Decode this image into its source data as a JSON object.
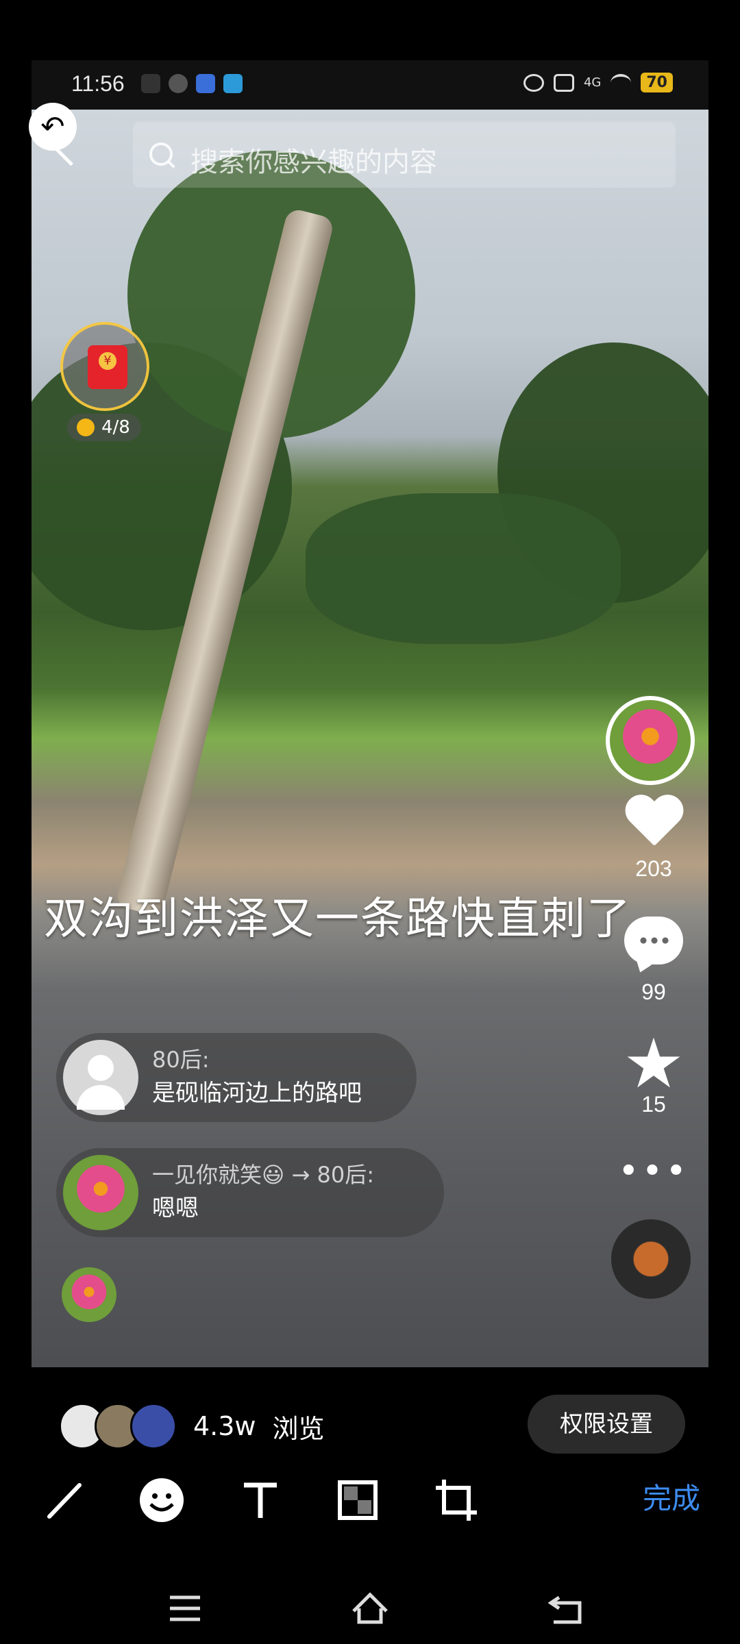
{
  "status_bar": {
    "time": "11:56",
    "battery": "70",
    "network": "4G"
  },
  "search": {
    "placeholder": "搜索你感兴趣的内容"
  },
  "red_packet": {
    "progress": "4/8"
  },
  "video": {
    "caption": "双沟到洪泽又一条路快直刺了"
  },
  "actions": {
    "likes": "203",
    "comments": "99",
    "favorites": "15"
  },
  "comments": [
    {
      "name": "80后:",
      "text": "是砚临河边上的路吧"
    },
    {
      "name": "一见你就笑😃 → 80后:",
      "text": "嗯嗯"
    }
  ],
  "viewers": {
    "count": "4.3w",
    "label": "浏览"
  },
  "buttons": {
    "permission": "权限设置",
    "done": "完成"
  },
  "colors": {
    "accent": "#3d8cf0",
    "background": "#000000"
  }
}
